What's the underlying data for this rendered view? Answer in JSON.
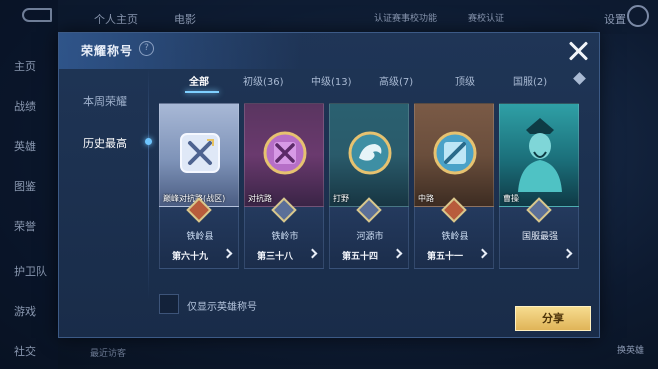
{
  "background": {
    "nav_items": [
      "主页",
      "战绩",
      "英雄",
      "图鉴",
      "荣誉",
      "护卫队",
      "游戏",
      "社交"
    ],
    "top_items": [
      "个人主页",
      "电影",
      "认证赛事校功能",
      "赛校认证"
    ],
    "settings_label": "设置",
    "bottom_text": "最近访客",
    "right_items": [
      "换英雄"
    ]
  },
  "modal": {
    "title": "荣耀称号",
    "help_glyph": "?",
    "close_label": "关闭"
  },
  "subnav": {
    "items": [
      {
        "label": "本周荣耀",
        "active": false
      },
      {
        "label": "历史最高",
        "active": true
      }
    ]
  },
  "tabs": [
    {
      "label": "全部",
      "active": true
    },
    {
      "label": "初级(36)",
      "active": false
    },
    {
      "label": "中级(13)",
      "active": false
    },
    {
      "label": "高级(7)",
      "active": false
    },
    {
      "label": "顶级",
      "active": false
    },
    {
      "label": "国服(2)",
      "active": false
    }
  ],
  "cards": [
    {
      "label": "巅峰对抗路(战区)",
      "region": "铁岭县",
      "rank": "第六十九",
      "emblem": "crossed-swords-icon",
      "theme": "#7e93b8"
    },
    {
      "label": "对抗路",
      "region": "铁岭市",
      "rank": "第三十八",
      "emblem": "crossed-swords-icon",
      "theme": "#6a3a6e"
    },
    {
      "label": "打野",
      "region": "河源市",
      "rank": "第五十四",
      "emblem": "dragon-icon",
      "theme": "#2a5b6b"
    },
    {
      "label": "中路",
      "region": "铁岭县",
      "rank": "第五十一",
      "emblem": "mid-lane-icon",
      "theme": "#6a4e3c"
    },
    {
      "label": "曹操",
      "region": "国服最强",
      "rank": "",
      "emblem": "hero-portrait-icon",
      "theme": "#1b6f7a"
    }
  ],
  "filter": {
    "label": "仅显示英雄称号",
    "checked": false
  },
  "share_label": "分享",
  "colors": {
    "accent": "#7fd0ff",
    "gold": "#e0b458"
  }
}
